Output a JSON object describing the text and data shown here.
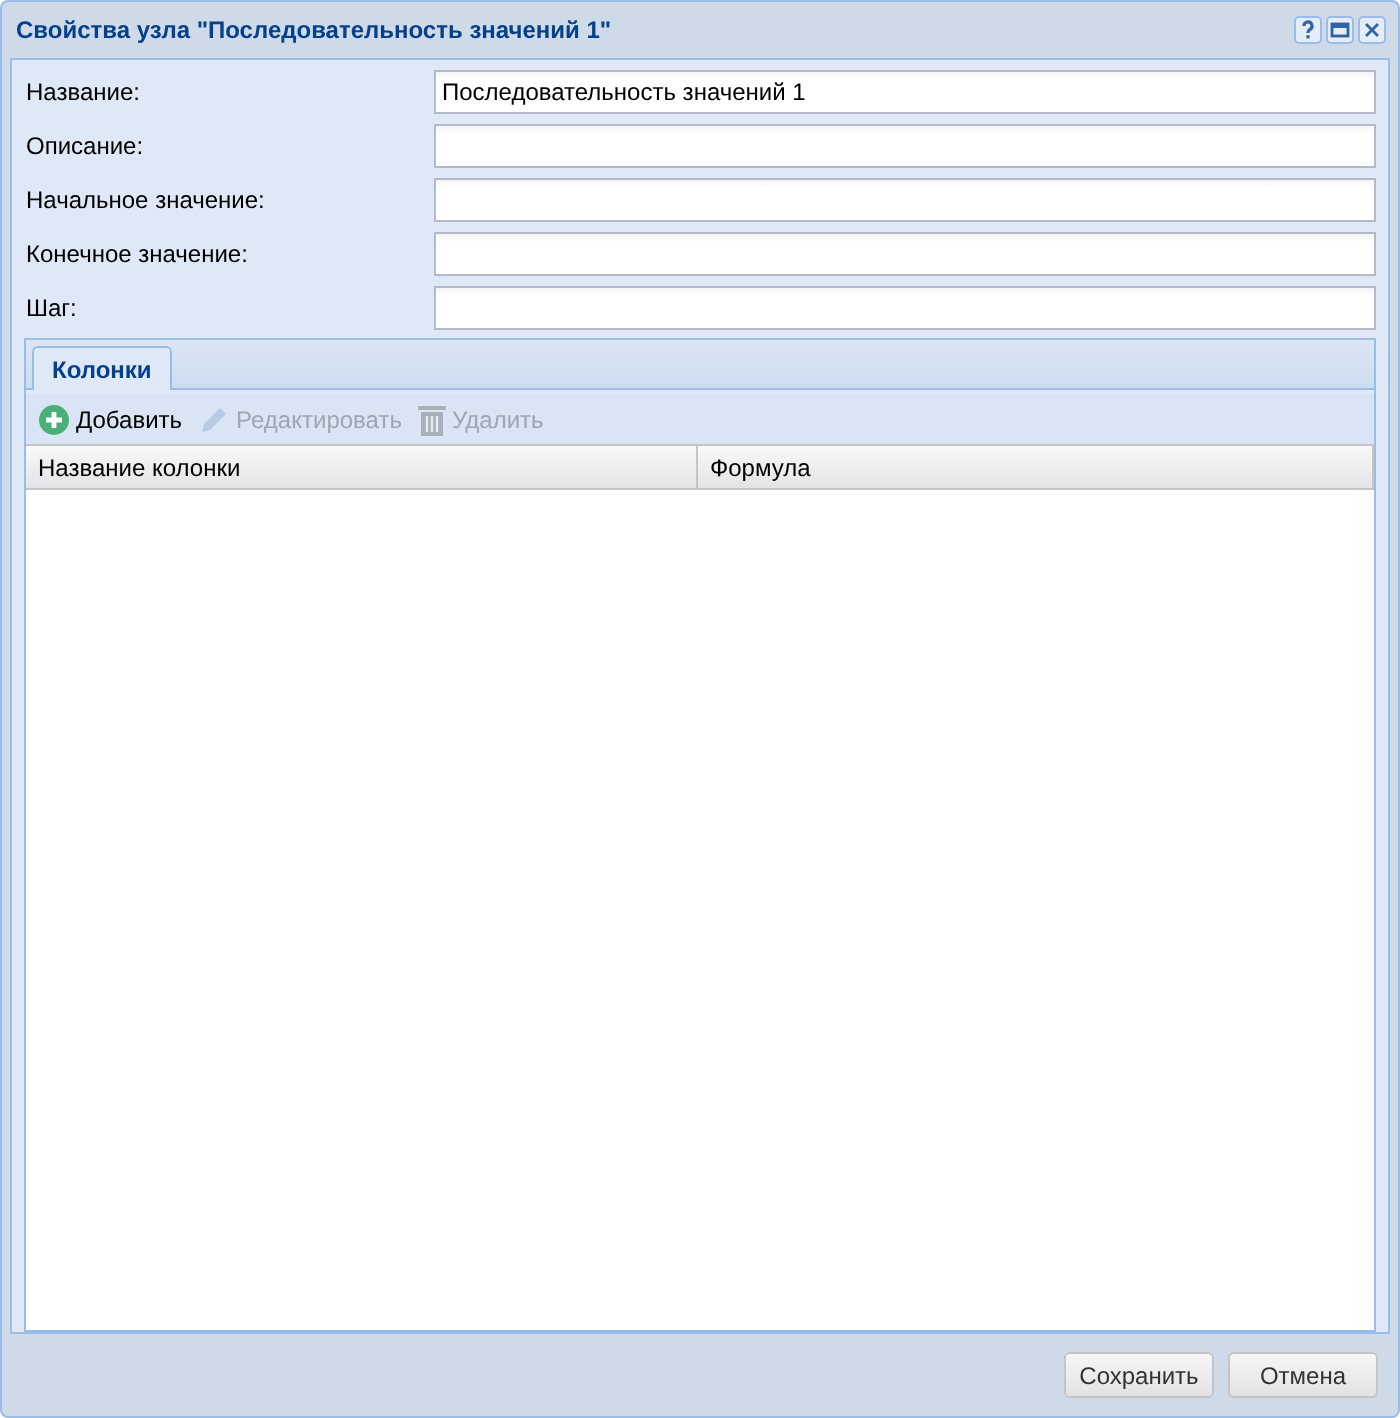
{
  "window": {
    "title": "Свойства узла \"Последовательность значений 1\"",
    "controls": [
      {
        "kind": "help"
      },
      {
        "kind": "maximize"
      },
      {
        "kind": "close"
      }
    ]
  },
  "fields": [
    {
      "label": "Название:",
      "value": "Последовательность значений 1"
    },
    {
      "label": "Описание:"
    },
    {
      "label": "Начальное значение:"
    },
    {
      "label": "Конечное значение:"
    },
    {
      "label": "Шаг:"
    }
  ],
  "tabs": [
    {
      "label": "Колонки",
      "selected": true
    }
  ],
  "toolbar": [
    {
      "kind": "add",
      "label": "Добавить",
      "disabled": false
    },
    {
      "kind": "edit",
      "label": "Редактировать",
      "disabled": true
    },
    {
      "kind": "delete",
      "label": "Удалить",
      "disabled": true
    }
  ],
  "table": {
    "columns": [
      "Название колонки",
      "Формула"
    ]
  },
  "buttons": [
    "Сохранить",
    "Отмена"
  ]
}
